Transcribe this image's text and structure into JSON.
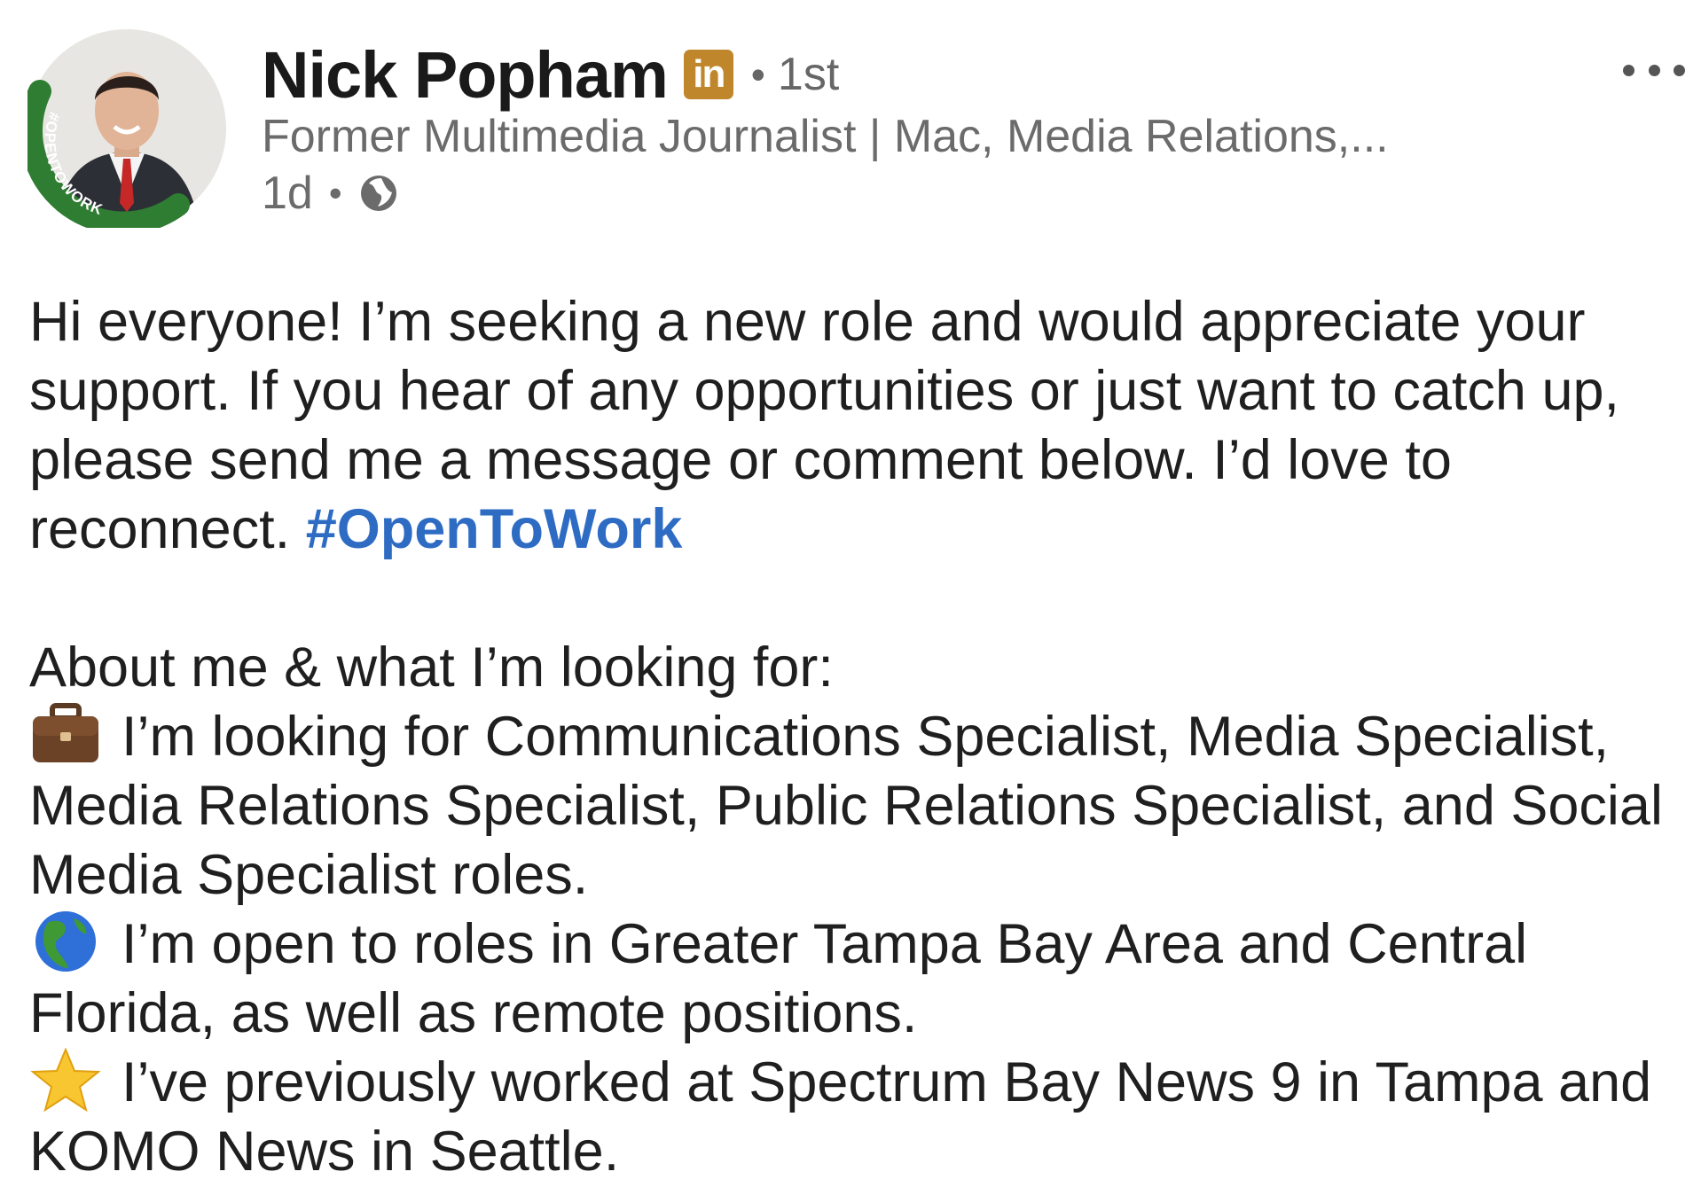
{
  "author": {
    "name": "Nick Popham",
    "badge": "in",
    "degree": "1st",
    "headline": "Former Multimedia Journalist | Mac, Media Relations,...",
    "timestamp": "1d",
    "frame_text": "#OPENTOWORK",
    "frame_color": "#2f7d32"
  },
  "post": {
    "intro": "Hi everyone! I’m seeking a new role and would appreciate your support. If you hear of any opportunities or just want to catch up, please send me a message or comment below. I’d love to reconnect.",
    "hashtag": "#OpenToWork",
    "about_heading": "About me & what I’m looking for:",
    "items": [
      {
        "icon": "briefcase-icon",
        "text": "I’m looking for Communications Specialist, Media Specialist, Media Relations Specialist, Public Relations Specialist, and Social Media Specialist roles."
      },
      {
        "icon": "globe-americas-icon",
        "text": "I’m open to roles in Greater Tampa Bay Area and Central Florida, as well as remote positions."
      },
      {
        "icon": "star-icon",
        "text": "I’ve previously worked at Spectrum Bay News 9 in Tampa and KOMO News in Seattle."
      }
    ]
  },
  "colors": {
    "hashtag": "#2e6cc4",
    "badge": "#c0862b",
    "secondary_text": "#6b6b6b"
  }
}
